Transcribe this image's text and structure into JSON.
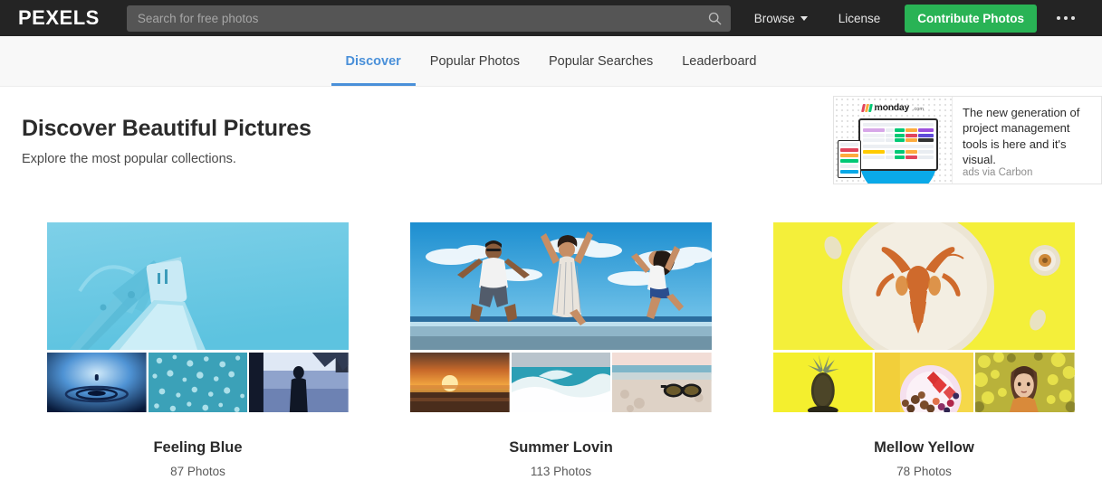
{
  "header": {
    "logo": "PEXELS",
    "search": {
      "placeholder": "Search for free photos",
      "value": "",
      "icon": "search-icon"
    },
    "nav": [
      {
        "label": "Browse",
        "has_caret": true
      },
      {
        "label": "License",
        "has_caret": false
      }
    ],
    "contribute_button": "Contribute Photos",
    "more_icon": "ellipsis-icon",
    "colors": {
      "bg": "#242424",
      "search_bg": "#555555",
      "button_green": "#29b355"
    }
  },
  "tabs": [
    {
      "label": "Discover",
      "active": true
    },
    {
      "label": "Popular Photos",
      "active": false
    },
    {
      "label": "Popular Searches",
      "active": false
    },
    {
      "label": "Leaderboard",
      "active": false
    }
  ],
  "tab_accent_color": "#4a90d9",
  "page": {
    "title": "Discover Beautiful Pictures",
    "subtitle": "Explore the most popular collections."
  },
  "ad": {
    "brand": "monday",
    "brand_suffix": ".com",
    "text": "The new generation of project management tools is here and it's visual.",
    "credit": "ads via Carbon"
  },
  "collections": [
    {
      "title": "Feeling Blue",
      "count": "87 Photos",
      "hero_alt": "blue-desk-lamp",
      "thumbs": [
        "water-droplet-ripple",
        "blue-water-bubbles",
        "silhouette-in-water"
      ]
    },
    {
      "title": "Summer Lovin",
      "count": "113 Photos",
      "hero_alt": "people-jumping-on-beach",
      "thumbs": [
        "beach-sunset",
        "ocean-wave",
        "sunglasses-on-sand"
      ]
    },
    {
      "title": "Mellow Yellow",
      "count": "78 Photos",
      "hero_alt": "lobster-on-plate-yellow",
      "thumbs": [
        "pineapple-yellow",
        "fruit-bowl",
        "woman-with-yellow-flowers"
      ]
    }
  ]
}
